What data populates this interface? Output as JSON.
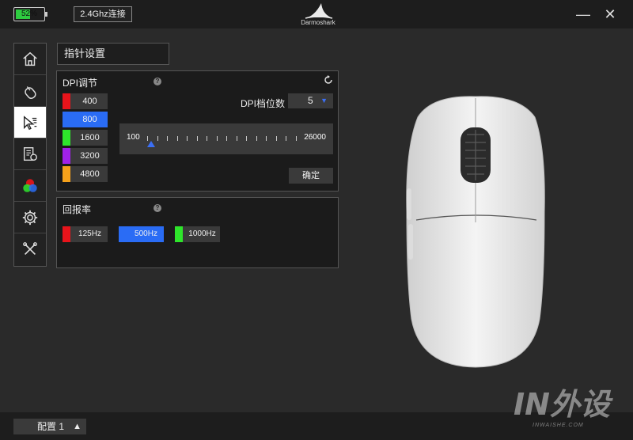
{
  "titlebar": {
    "battery_percent_label": "52%",
    "battery_level": 0.52,
    "connection_label": "2.4Ghz连接",
    "brand": "Darmoshark",
    "minimize_symbol": "—",
    "close_symbol": "✕"
  },
  "sidebar": {
    "items": [
      {
        "icon": "home-icon",
        "active": false
      },
      {
        "icon": "mouse-icon",
        "active": false
      },
      {
        "icon": "pointer-settings-icon",
        "active": true
      },
      {
        "icon": "macro-icon",
        "active": false
      },
      {
        "icon": "rgb-lighting-icon",
        "active": false
      },
      {
        "icon": "gear-icon",
        "active": false
      },
      {
        "icon": "tools-icon",
        "active": false
      }
    ]
  },
  "section": {
    "title": "指针设置"
  },
  "dpi_panel": {
    "title": "DPI调节",
    "help": "?",
    "levels": [
      {
        "value": "400",
        "color": "#e8141b",
        "selected": false
      },
      {
        "value": "800",
        "color": "#2a6cf5",
        "selected": true
      },
      {
        "value": "1600",
        "color": "#2ee52b",
        "selected": false
      },
      {
        "value": "3200",
        "color": "#a021e8",
        "selected": false
      },
      {
        "value": "4800",
        "color": "#f5a11b",
        "selected": false
      }
    ],
    "levels_count_label": "DPI档位数",
    "levels_count_value": "5",
    "dropdown_arrow": "▼",
    "slider": {
      "min_label": "100",
      "max_label": "26000",
      "min": 100,
      "max": 26000,
      "value": 800
    },
    "confirm_label": "确定"
  },
  "rate_panel": {
    "title": "回报率",
    "help": "?",
    "options": [
      {
        "value": "125Hz",
        "color": "#e8141b",
        "selected": false
      },
      {
        "value": "500Hz",
        "color": "#2a6cf5",
        "selected": true
      },
      {
        "value": "1000Hz",
        "color": "#2ee52b",
        "selected": false
      }
    ]
  },
  "bottombar": {
    "profile_label": "配置 1",
    "caret": "▲"
  },
  "watermark": {
    "text": "IN外设",
    "sub": "INWAISHE.COM"
  },
  "colors": {
    "accent": "#2a6cf5",
    "panel_bg": "#1b1b1b",
    "app_bg": "#2a2a2a"
  }
}
